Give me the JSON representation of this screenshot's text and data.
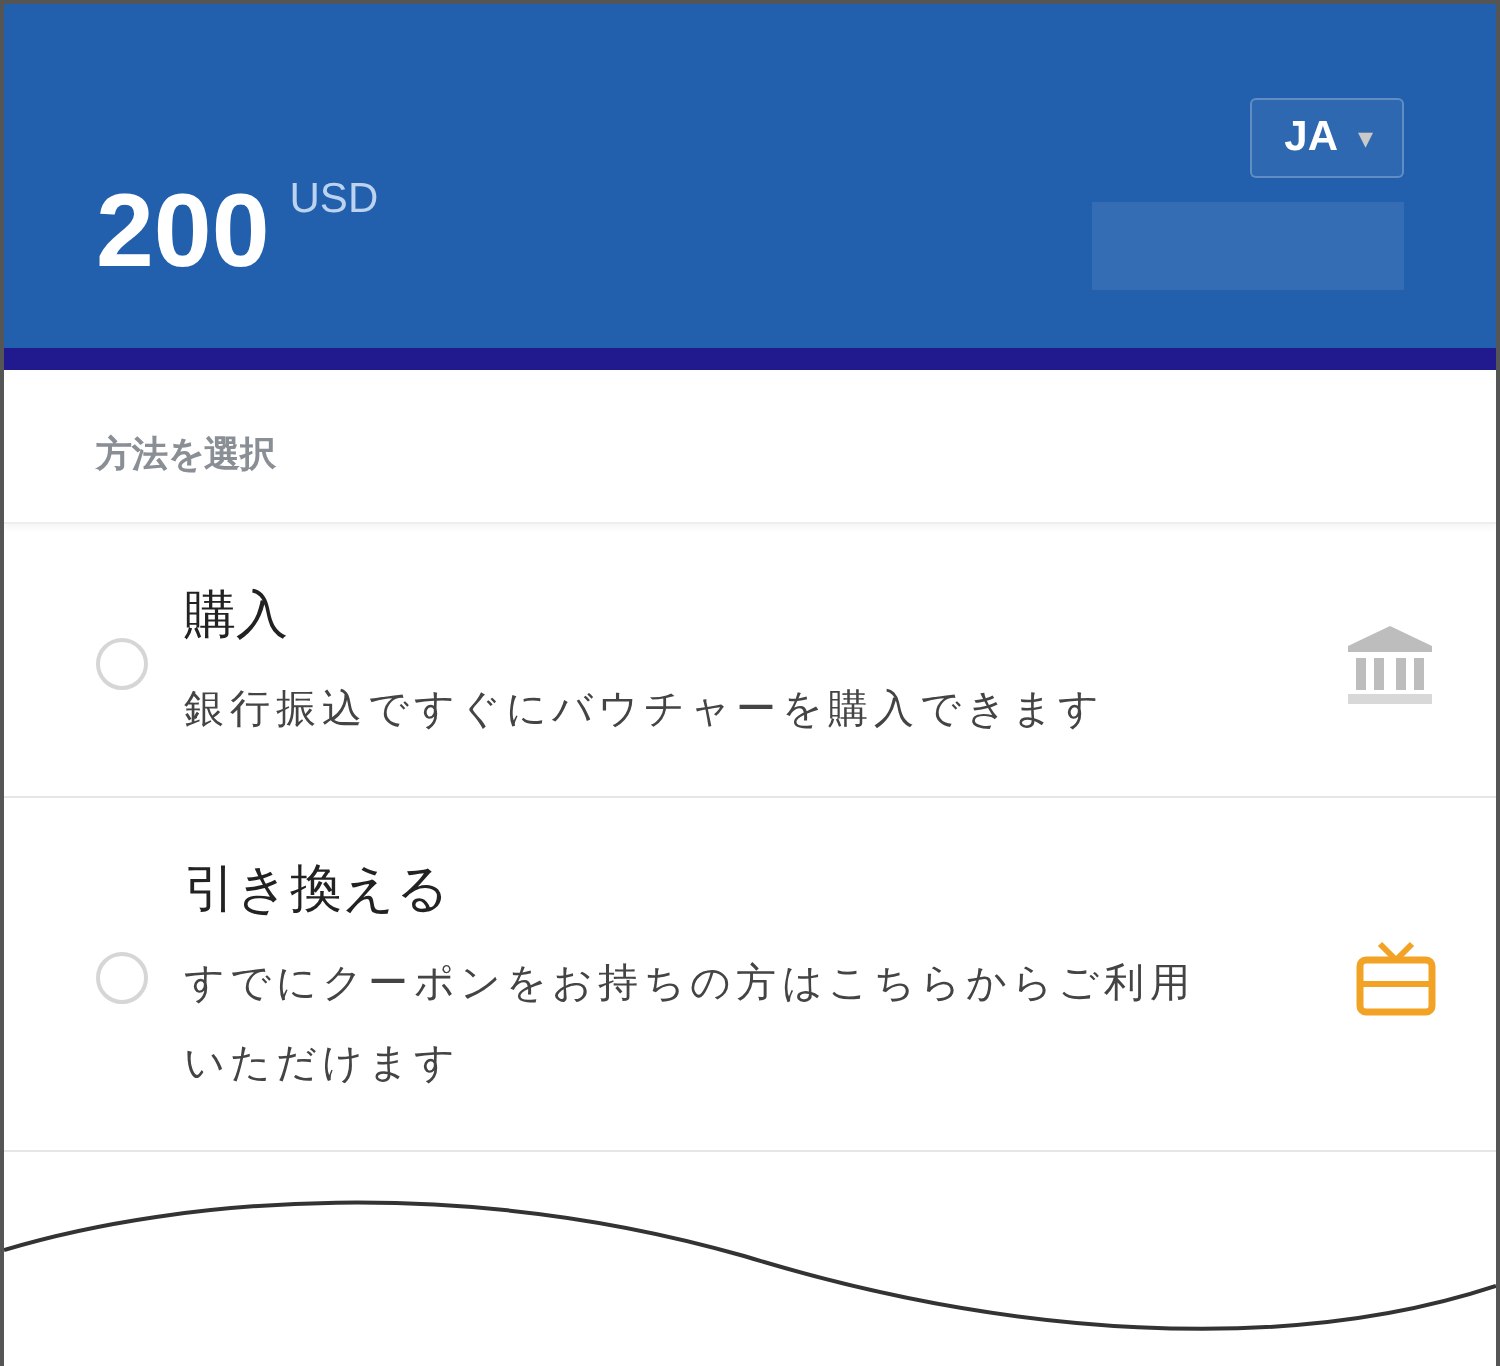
{
  "header": {
    "amount": "200",
    "currency": "USD",
    "language": {
      "label": "JA",
      "arrow": "▾"
    }
  },
  "section_label": "方法を選択",
  "options": [
    {
      "title": "購入",
      "description": "銀行振込ですぐにバウチャーを購入できます",
      "selected": false
    },
    {
      "title": "引き換える",
      "description": "すでにクーポンをお持ちの方はこちらからご利用いただけます",
      "selected": false
    }
  ]
}
